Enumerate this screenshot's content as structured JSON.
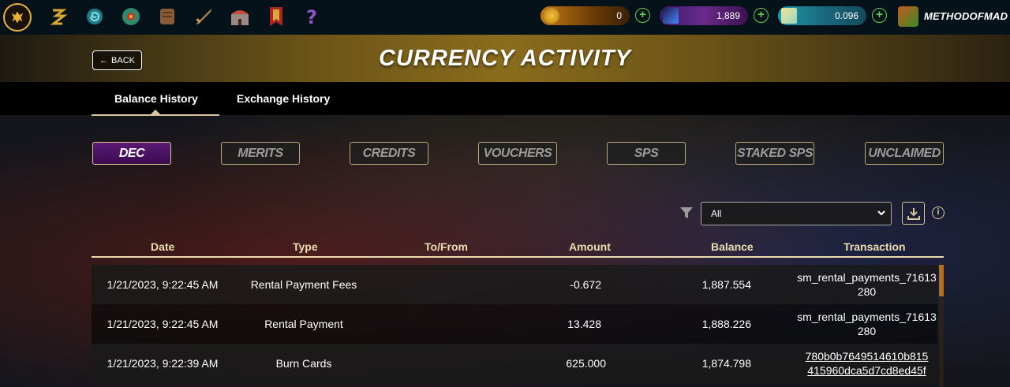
{
  "header": {
    "currencies": [
      {
        "name": "dec-coin",
        "value": "0",
        "color": "#b26a10"
      },
      {
        "name": "credits",
        "value": "1,889",
        "color": "#5a1d7a"
      },
      {
        "name": "sps",
        "value": "0.096",
        "color": "#1c8aa0"
      }
    ],
    "username": "METHODOFMAD",
    "nav_icons": [
      "logo-icon",
      "hat-icon",
      "swirl-icon",
      "flower-icon",
      "scroll-icon",
      "sword-icon",
      "castle-icon",
      "banner-icon",
      "question-icon"
    ]
  },
  "page": {
    "back_label": "BACK",
    "title": "CURRENCY ACTIVITY"
  },
  "tabs": [
    {
      "label": "Balance History",
      "active": true
    },
    {
      "label": "Exchange History",
      "active": false
    }
  ],
  "currency_buttons": [
    {
      "label": "DEC",
      "active": true
    },
    {
      "label": "MERITS",
      "active": false
    },
    {
      "label": "CREDITS",
      "active": false
    },
    {
      "label": "VOUCHERS",
      "active": false
    },
    {
      "label": "SPS",
      "active": false
    },
    {
      "label": "STAKED SPS",
      "active": false
    },
    {
      "label": "UNCLAIMED",
      "active": false
    }
  ],
  "filter": {
    "selected": "All"
  },
  "table": {
    "columns": [
      "Date",
      "Type",
      "To/From",
      "Amount",
      "Balance",
      "Transaction"
    ],
    "rows": [
      {
        "date": "1/21/2023, 9:22:45 AM",
        "type": "Rental Payment Fees",
        "to_from": "",
        "amount": "-0.672",
        "balance": "1,887.554",
        "transaction": "sm_rental_payments_71613280",
        "link": false
      },
      {
        "date": "1/21/2023, 9:22:45 AM",
        "type": "Rental Payment",
        "to_from": "",
        "amount": "13.428",
        "balance": "1,888.226",
        "transaction": "sm_rental_payments_71613280",
        "link": false
      },
      {
        "date": "1/21/2023, 9:22:39 AM",
        "type": "Burn Cards",
        "to_from": "",
        "amount": "625.000",
        "balance": "1,874.798",
        "transaction": "780b0b7649514610b815415960dca5d7cd8ed45f",
        "link": true
      }
    ]
  }
}
